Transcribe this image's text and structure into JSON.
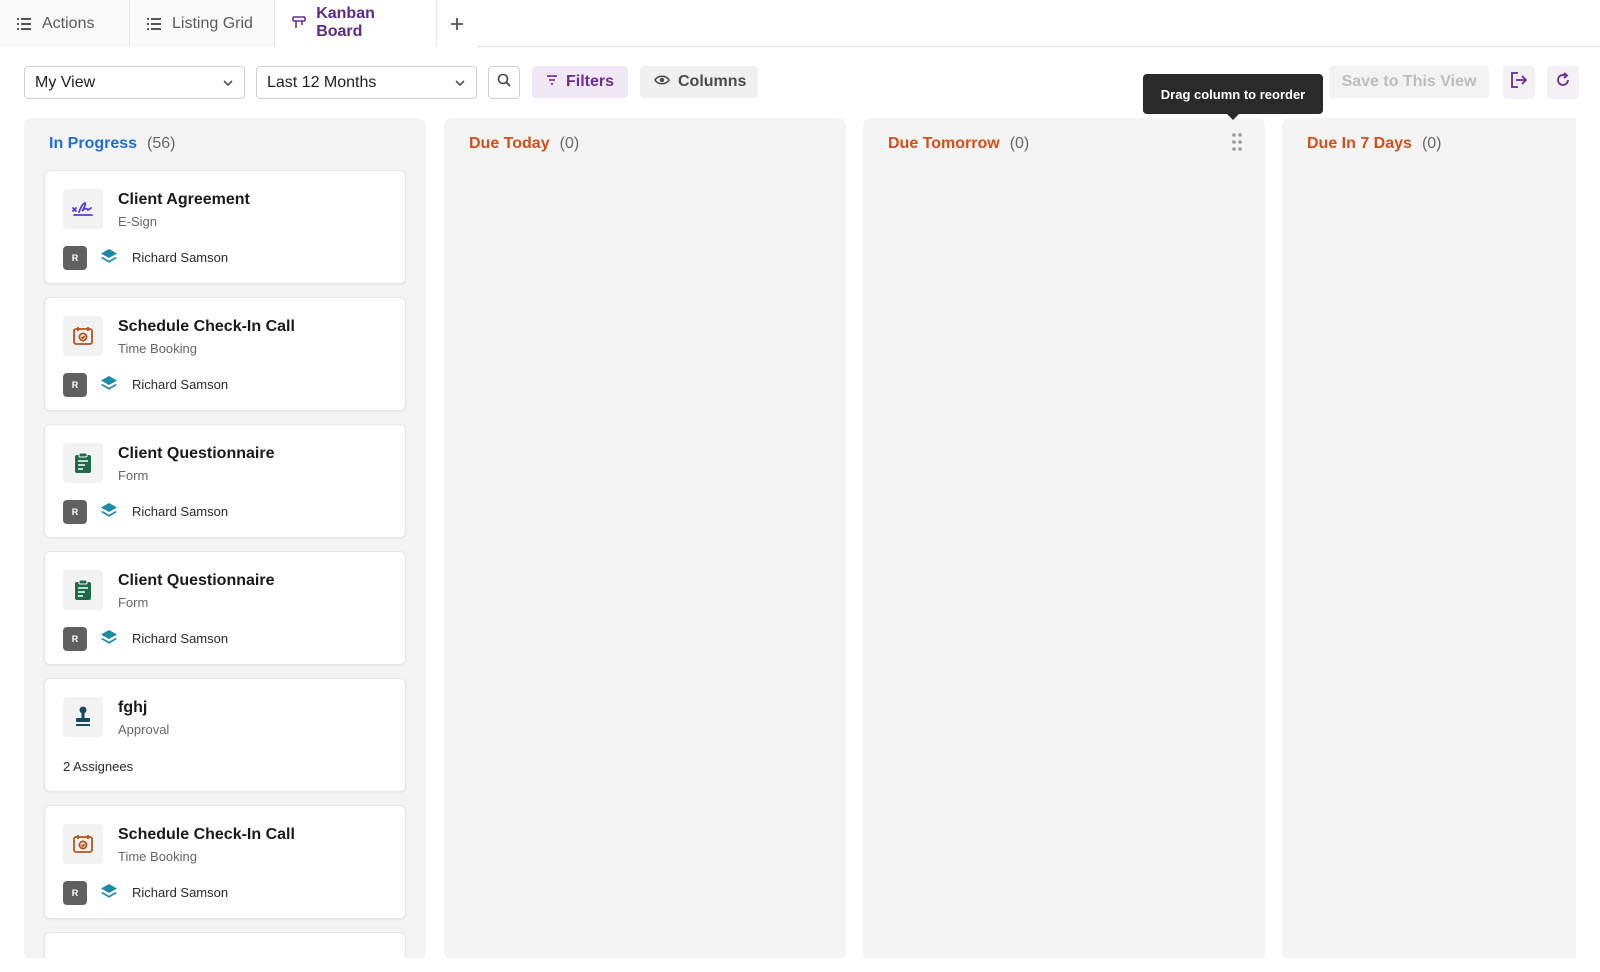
{
  "tabs": [
    {
      "label": "Actions"
    },
    {
      "label": "Listing Grid"
    },
    {
      "label": "Kanban Board"
    }
  ],
  "toolbar": {
    "view": "My View",
    "range": "Last 12 Months",
    "filters_label": "Filters",
    "columns_label": "Columns",
    "save_label": "Save to This View"
  },
  "tooltip": "Drag column to reorder",
  "columns": [
    {
      "title": "In Progress",
      "count": "(56)",
      "color": "#1f6fd1"
    },
    {
      "title": "Due Today",
      "count": "(0)",
      "color": "#d1501a"
    },
    {
      "title": "Due Tomorrow",
      "count": "(0)",
      "color": "#d1501a"
    },
    {
      "title": "Due In 7 Days",
      "count": "(0)",
      "color": "#d1501a"
    }
  ],
  "cards": [
    {
      "title": "Client Agreement",
      "type": "E-Sign",
      "avatar": "R",
      "assignee": "Richard Samson",
      "icon": "esign-icon"
    },
    {
      "title": "Schedule Check-In Call",
      "type": "Time Booking",
      "avatar": "R",
      "assignee": "Richard Samson",
      "icon": "calendar-check-icon"
    },
    {
      "title": "Client Questionnaire",
      "type": "Form",
      "avatar": "R",
      "assignee": "Richard Samson",
      "icon": "clipboard-form-icon"
    },
    {
      "title": "Client Questionnaire",
      "type": "Form",
      "avatar": "R",
      "assignee": "Richard Samson",
      "icon": "clipboard-form-icon"
    },
    {
      "title": "fghj",
      "type": "Approval",
      "assignees": "2 Assignees",
      "icon": "stamp-icon"
    },
    {
      "title": "Schedule Check-In Call",
      "type": "Time Booking",
      "avatar": "R",
      "assignee": "Richard Samson",
      "icon": "calendar-check-icon"
    }
  ],
  "colors": {
    "accent_purple": "#6b2d8f",
    "in_progress_blue": "#1f6fd1",
    "due_orange": "#d1501a"
  }
}
